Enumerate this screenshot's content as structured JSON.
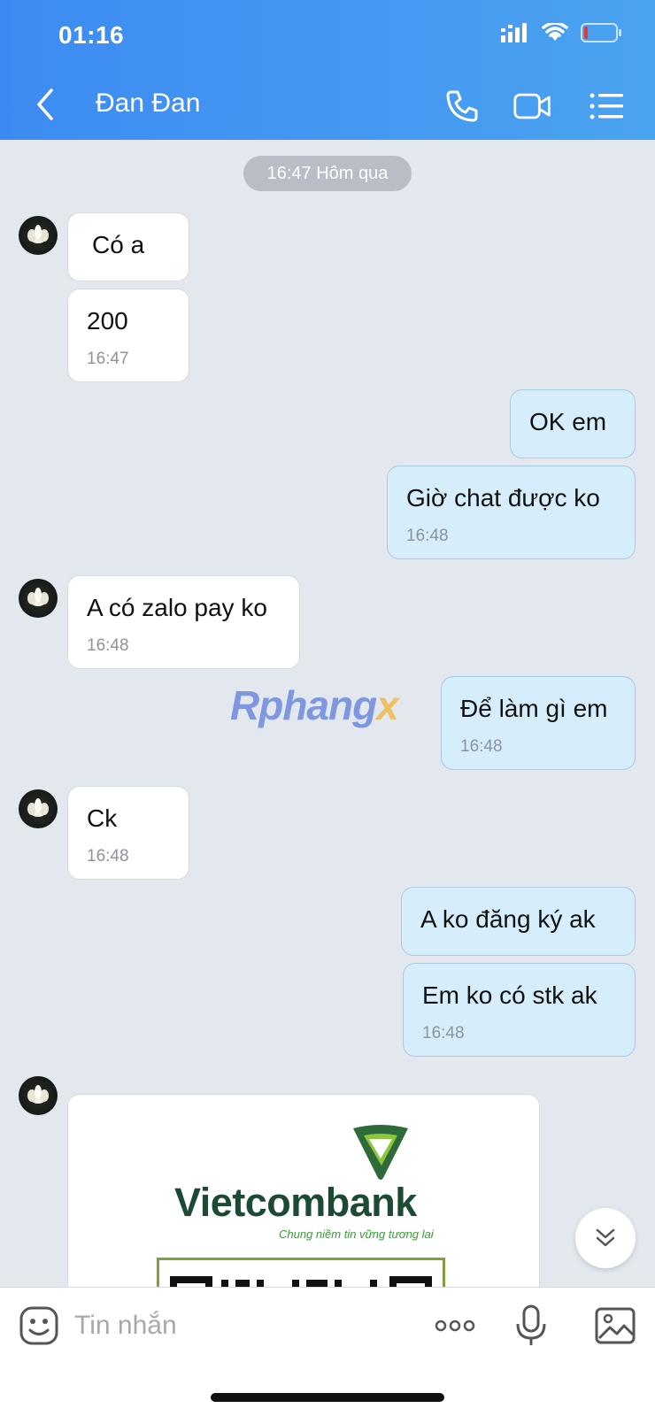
{
  "status_bar": {
    "time": "01:16"
  },
  "header": {
    "title": "Đan Đan"
  },
  "date_separator": "16:47 Hôm qua",
  "messages": [
    {
      "dir": "in",
      "text": "Có a"
    },
    {
      "dir": "in",
      "text": "200",
      "time": "16:47"
    },
    {
      "dir": "out",
      "text": "OK em"
    },
    {
      "dir": "out",
      "text": "Giờ chat được ko",
      "time": "16:48"
    },
    {
      "dir": "in",
      "text": "A có zalo pay ko",
      "time": "16:48"
    },
    {
      "dir": "out",
      "text": "Để làm gì em",
      "time": "16:48"
    },
    {
      "dir": "in",
      "text": "Ck",
      "time": "16:48"
    },
    {
      "dir": "out",
      "text": "A ko đăng ký ak"
    },
    {
      "dir": "out",
      "text": "Em ko có stk ak",
      "time": "16:48"
    }
  ],
  "image_message": {
    "bank_name": "Vietcombank",
    "slogan": "Chung niềm tin vững tương lai"
  },
  "watermark": {
    "main": "Rphang",
    "accent": "x"
  },
  "composer": {
    "placeholder": "Tin nhắn"
  },
  "icons": {
    "header": [
      "back-icon",
      "phone-icon",
      "video-icon",
      "menu-list-icon"
    ],
    "composer": [
      "sticker-icon",
      "more-icon",
      "microphone-icon",
      "image-icon"
    ],
    "other": [
      "scroll-down-icon",
      "avatar"
    ]
  },
  "colors": {
    "header_start": "#3d8bf2",
    "header_end": "#4aa3f0",
    "outgoing_bubble": "#d6edfb",
    "background": "#e3e8ef"
  }
}
